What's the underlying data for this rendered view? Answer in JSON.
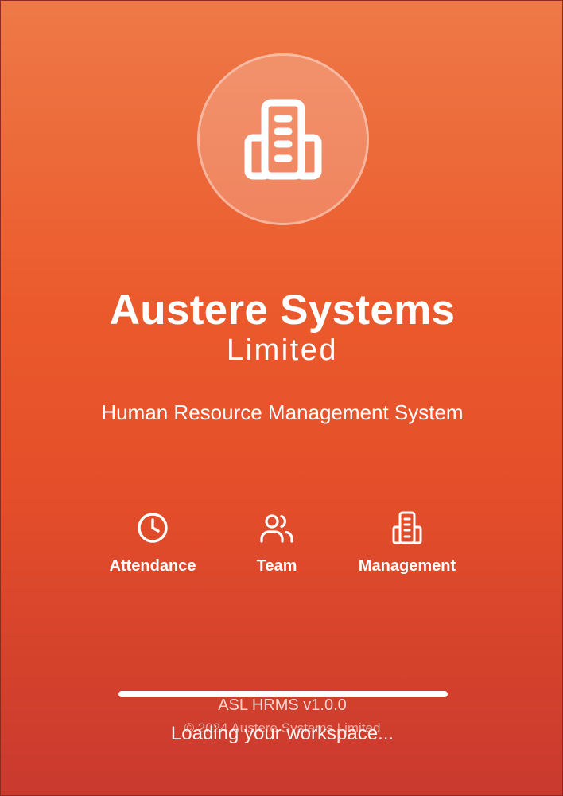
{
  "splash": {
    "logo_icon": "building-icon",
    "company_name": "Austere Systems",
    "company_suffix": "Limited",
    "subtitle": "Human Resource Management System",
    "features": [
      {
        "icon": "clock-icon",
        "label": "Attendance"
      },
      {
        "icon": "users-icon",
        "label": "Team"
      },
      {
        "icon": "building-icon",
        "label": "Management"
      }
    ],
    "progress": 1.0,
    "version": "ASL HRMS v1.0.0",
    "copyright": "© 2024 Austere Systems Limited",
    "loading_text": "Loading your workspace..."
  },
  "colors": {
    "gradient_top": "#ee7947",
    "gradient_mid": "#e44e2a",
    "gradient_bottom": "#c9392e",
    "text": "#ffffff"
  }
}
